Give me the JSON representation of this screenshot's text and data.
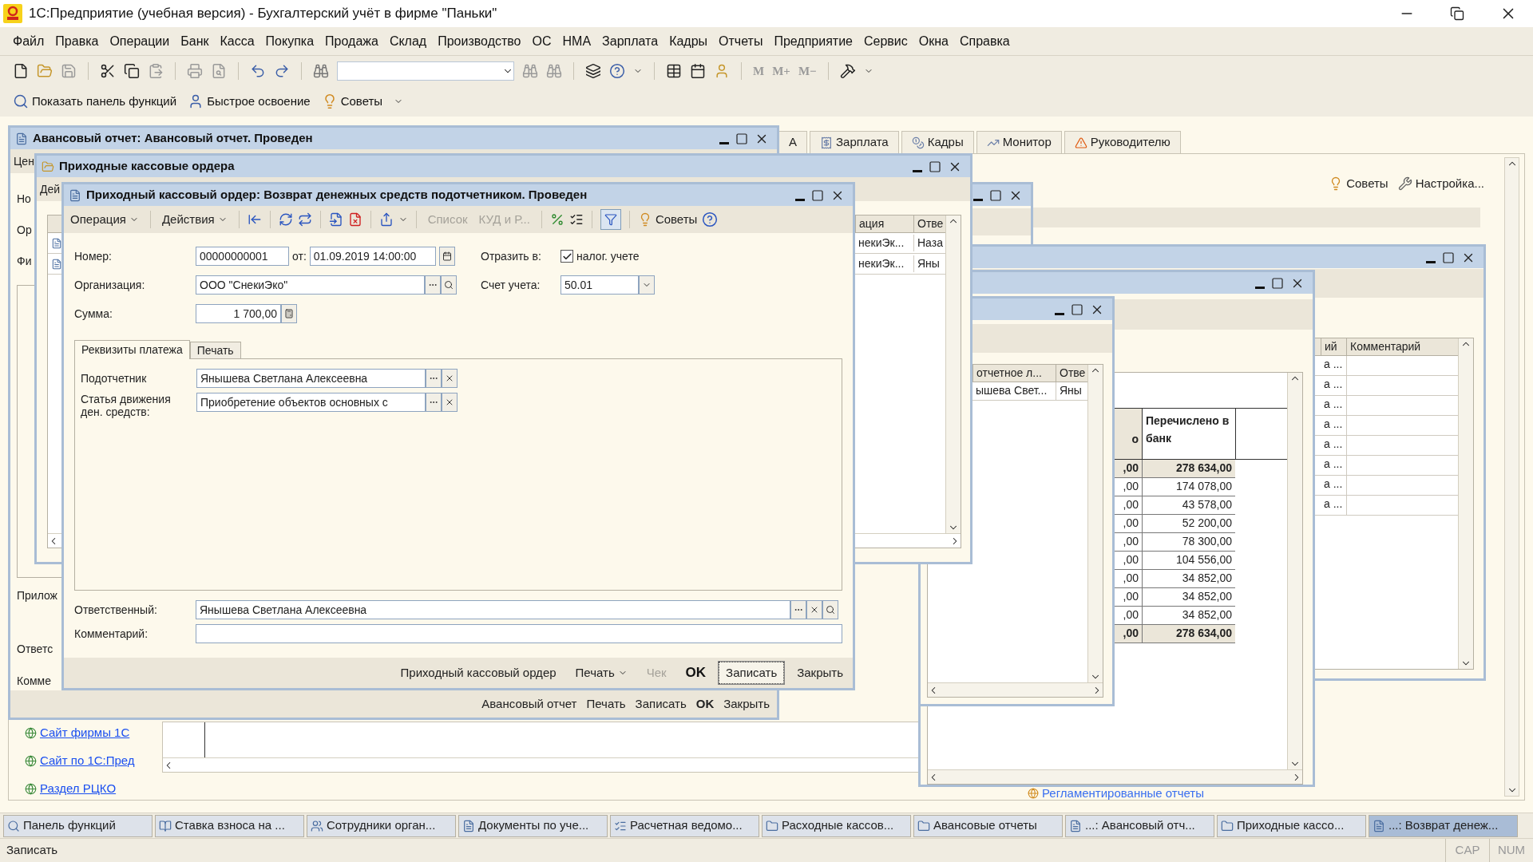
{
  "window": {
    "title": "1С:Предприятие (учебная версия) - Бухгалтерский учёт в фирме \"Паньки\""
  },
  "menu": [
    "Файл",
    "Правка",
    "Операции",
    "Банк",
    "Касса",
    "Покупка",
    "Продажа",
    "Склад",
    "Производство",
    "ОС",
    "НМА",
    "Зарплата",
    "Кадры",
    "Отчеты",
    "Предприятие",
    "Сервис",
    "Окна",
    "Справка"
  ],
  "toolbar": {
    "memory_buttons": [
      "M",
      "M+",
      "M−"
    ]
  },
  "quick_bar": [
    "Показать панель функций",
    "Быстрое освоение",
    "Советы"
  ],
  "function_panel": {
    "tabs": [
      {
        "label": "А",
        "selected": false
      },
      {
        "label": "Зарплата",
        "selected": false
      },
      {
        "label": "Кадры",
        "selected": false
      },
      {
        "label": "Монитор",
        "selected": false
      },
      {
        "label": "Руководителю",
        "selected": false
      }
    ],
    "actions": [
      "Советы",
      "Настройка..."
    ],
    "links": [
      "Сайт фирмы 1С",
      "Сайт по 1С:Пред",
      "Раздел РЦКО"
    ],
    "reports_link": "Регламентированные отчеты"
  },
  "comments_window": {
    "columns": [
      "ий",
      "Комментарий"
    ],
    "rows": [
      "а ...",
      "а ...",
      "а ...",
      "а ...",
      "а ...",
      "а ...",
      "а ...",
      "а ..."
    ]
  },
  "transfer_window": {
    "columns": [
      "о",
      "Перечислено в банк"
    ],
    "rows": [
      {
        "kind": "total",
        "cells": [
          ",00",
          "278 634,00"
        ]
      },
      {
        "kind": "row",
        "cells": [
          ",00",
          "174 078,00"
        ]
      },
      {
        "kind": "row",
        "cells": [
          ",00",
          "43 578,00"
        ]
      },
      {
        "kind": "row",
        "cells": [
          ",00",
          "52 200,00"
        ]
      },
      {
        "kind": "row",
        "cells": [
          ",00",
          "78 300,00"
        ]
      },
      {
        "kind": "row",
        "cells": [
          ",00",
          "104 556,00"
        ]
      },
      {
        "kind": "row",
        "cells": [
          ",00",
          "34 852,00"
        ]
      },
      {
        "kind": "row",
        "cells": [
          ",00",
          "34 852,00"
        ]
      },
      {
        "kind": "row",
        "cells": [
          ",00",
          "34 852,00"
        ]
      },
      {
        "kind": "total",
        "cells": [
          ",00",
          "278 634,00"
        ]
      }
    ]
  },
  "accountable_list_window": {
    "columns": [
      "отчетное л...",
      "Отве"
    ],
    "rows": [
      [
        "ышева Свет...",
        "Яны"
      ]
    ]
  },
  "advance_report_window": {
    "title": "Авансовый отчет: Авансовый отчет. Проведен",
    "toolbar_label": "Цен",
    "labels": [
      "Но",
      "Ор",
      "Фи",
      "Прилож",
      "Ответс",
      "Комме"
    ],
    "buttons": [
      "Авансовый отчет",
      "Печать",
      "Записать",
      "OK",
      "Закрыть"
    ]
  },
  "cash_orders_window": {
    "title": "Приходные кассовые ордера",
    "toolbar_label": "Дей",
    "columns": [
      "ация",
      "Отве"
    ],
    "rows": [
      [
        "некиЭк...",
        "Наза"
      ],
      [
        "некиЭк...",
        "Яны"
      ]
    ]
  },
  "document_form": {
    "title": "Приходный кассовый ордер: Возврат денежных средств подотчетником. Проведен",
    "toolbar": {
      "menus": [
        "Операция",
        "Действия"
      ],
      "buttons": [
        {
          "label": "Список",
          "disabled": true
        },
        {
          "label": "КУД и Р...",
          "disabled": true
        }
      ],
      "filter_pressed": true,
      "tips": "Советы"
    },
    "number": {
      "label": "Номер:",
      "value": "00000000001"
    },
    "date": {
      "label": "от:",
      "value": "01.09.2019 14:00:00"
    },
    "organization": {
      "label": "Организация:",
      "value": "ООО \"СнекиЭко\""
    },
    "sum": {
      "label": "Сумма:",
      "value": "1 700,00"
    },
    "reflect": {
      "label": "Отразить в:",
      "option": "налог. учете",
      "checked": true
    },
    "account": {
      "label": "Счет учета:",
      "value": "50.01"
    },
    "tabs": [
      {
        "label": "Реквизиты платежа",
        "selected": true
      },
      {
        "label": "Печать",
        "selected": false
      }
    ],
    "accountable": {
      "label": "Подотчетник",
      "value": "Янышева Светлана Алексеевна"
    },
    "cash_flow_item": {
      "label": "Статья движения ден. средств:",
      "value": "Приобретение объектов основных с"
    },
    "responsible": {
      "label": "Ответственный:",
      "value": "Янышева Светлана Алексеевна"
    },
    "comment": {
      "label": "Комментарий:"
    },
    "buttons": [
      {
        "label": "Приходный кассовый ордер",
        "kind": "plain"
      },
      {
        "label": "Печать",
        "kind": "menu"
      },
      {
        "label": "Чек",
        "kind": "disabled"
      },
      {
        "label": "OK",
        "kind": "default"
      },
      {
        "label": "Записать",
        "kind": "focused"
      },
      {
        "label": "Закрыть",
        "kind": "plain"
      }
    ]
  },
  "taskbar": [
    {
      "label": "Панель функций",
      "selected": false
    },
    {
      "label": "Ставка взноса на ...",
      "selected": false
    },
    {
      "label": "Сотрудники орган...",
      "selected": false
    },
    {
      "label": "Документы по уче...",
      "selected": false
    },
    {
      "label": "Расчетная ведомо...",
      "selected": false
    },
    {
      "label": "Расходные кассов...",
      "selected": false
    },
    {
      "label": "Авансовые отчеты",
      "selected": false
    },
    {
      "label": "...: Авансовый отч...",
      "selected": false
    },
    {
      "label": "Приходные кассо...",
      "selected": false
    },
    {
      "label": "...: Возврат денеж...",
      "selected": true
    }
  ],
  "status_bar": {
    "message": "Записать",
    "indicators": [
      "CAP",
      "NUM"
    ]
  }
}
